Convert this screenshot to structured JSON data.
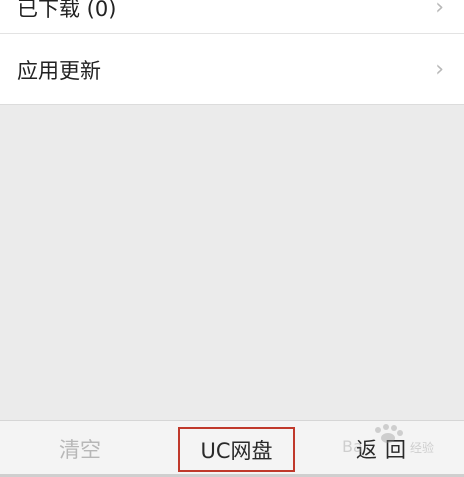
{
  "list": {
    "items": [
      {
        "label": "已下载 (0)",
        "chevron": "›"
      },
      {
        "label": "应用更新",
        "chevron": "›"
      }
    ]
  },
  "toolbar": {
    "clear_label": "清空",
    "cloud_label": "UC网盘",
    "back_label": "返回"
  },
  "colors": {
    "highlight_border": "#c0392b",
    "disabled_text": "#b7b7b7",
    "background": "#ebebeb"
  },
  "watermark": {
    "brand": "Baidu 经验"
  }
}
